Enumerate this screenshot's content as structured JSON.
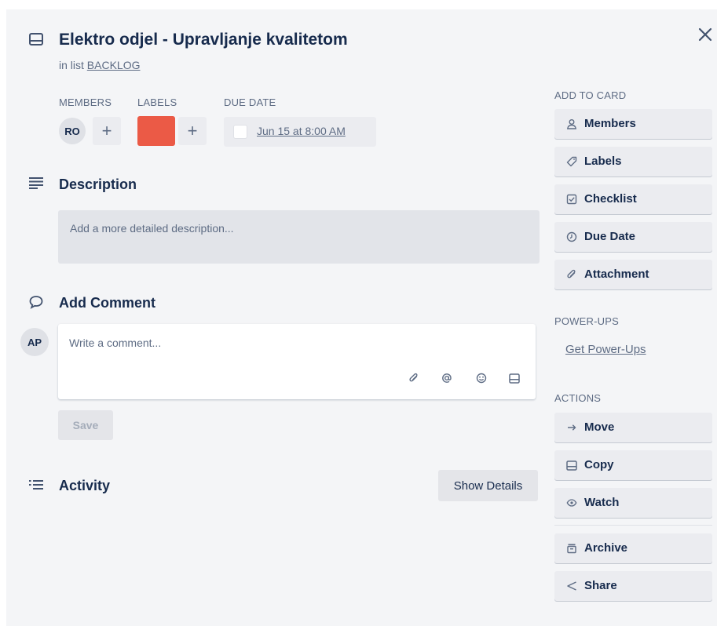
{
  "header": {
    "title": "Elektro odjel - Upravljanje kvalitetom",
    "in_list_prefix": "in list",
    "list_name": "BACKLOG"
  },
  "meta": {
    "members_label": "MEMBERS",
    "labels_label": "LABELS",
    "due_label": "DUE DATE",
    "member_initials": "RO",
    "add_symbol": "+",
    "label_color": "#eb5a46",
    "due_value": "Jun 15 at 8:00 AM"
  },
  "description": {
    "title": "Description",
    "placeholder": "Add a more detailed description..."
  },
  "comment": {
    "title": "Add Comment",
    "user_initials": "AP",
    "placeholder": "Write a comment...",
    "save_label": "Save",
    "tools": [
      "attachment-icon",
      "mention-icon",
      "emoji-icon",
      "card-icon"
    ]
  },
  "activity": {
    "title": "Activity",
    "show_details_label": "Show Details"
  },
  "sidebar": {
    "add_to_card_heading": "ADD TO CARD",
    "add_to_card": [
      {
        "label": "Members",
        "icon": "person-icon"
      },
      {
        "label": "Labels",
        "icon": "tag-icon"
      },
      {
        "label": "Checklist",
        "icon": "checklist-icon"
      },
      {
        "label": "Due Date",
        "icon": "clock-icon"
      },
      {
        "label": "Attachment",
        "icon": "paperclip-icon"
      }
    ],
    "powerups_heading": "POWER-UPS",
    "powerups_link": "Get Power-Ups",
    "actions_heading": "ACTIONS",
    "actions": [
      {
        "label": "Move",
        "icon": "arrow-right-icon"
      },
      {
        "label": "Copy",
        "icon": "card-icon"
      },
      {
        "label": "Watch",
        "icon": "eye-icon"
      },
      {
        "label": "Archive",
        "icon": "archive-icon"
      },
      {
        "label": "Share",
        "icon": "share-icon"
      }
    ]
  },
  "colors": {
    "background": "#f4f5f7",
    "label_red": "#eb5a46",
    "button_grey": "#ebecf0",
    "text_dark": "#172b4d",
    "text_muted": "#5e6c84"
  }
}
